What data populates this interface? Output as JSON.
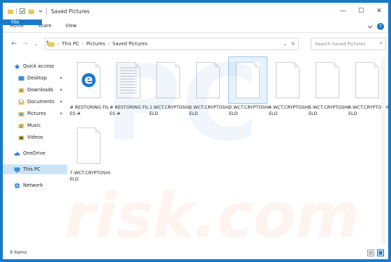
{
  "window": {
    "title": "Saved Pictures"
  },
  "ribbon": {
    "tabs": [
      "File",
      "Home",
      "Share",
      "View"
    ]
  },
  "address": {
    "crumbs": [
      "This PC",
      "Pictures",
      "Saved Pictures"
    ]
  },
  "search": {
    "placeholder": "Search Saved Pictures"
  },
  "sidebar": {
    "items": [
      {
        "label": "Quick access",
        "icon": "star-icon"
      },
      {
        "label": "Desktop",
        "icon": "desktop-folder-icon"
      },
      {
        "label": "Downloads",
        "icon": "downloads-folder-icon"
      },
      {
        "label": "Documents",
        "icon": "documents-folder-icon"
      },
      {
        "label": "Pictures",
        "icon": "pictures-folder-icon"
      },
      {
        "label": "Music",
        "icon": "music-folder-icon"
      },
      {
        "label": "Videos",
        "icon": "videos-folder-icon"
      },
      {
        "label": "OneDrive",
        "icon": "onedrive-cloud-icon"
      },
      {
        "label": "This PC",
        "icon": "computer-icon"
      },
      {
        "label": "Network",
        "icon": "network-icon"
      }
    ]
  },
  "files": [
    {
      "label": "# RESTORING FILES #",
      "type": "edge-html"
    },
    {
      "label": "# RESTORING FILES #",
      "type": "text"
    },
    {
      "label": "1.WCT.CRYPTOSHIELD",
      "type": "blank"
    },
    {
      "label": "2.WCT.CRYPTOSHIELD",
      "type": "blank"
    },
    {
      "label": "3.WCT.CRYPTOSHIELD",
      "type": "blank",
      "selected": true
    },
    {
      "label": "4.WCT.CRYPTOSHIELD",
      "type": "blank"
    },
    {
      "label": "5.WCT.CRYPTOSHIELD",
      "type": "blank"
    },
    {
      "label": "6.WCT.CRYPTOSHIELD",
      "type": "blank"
    },
    {
      "label": "7.WCT.CRYPTOSHIELD",
      "type": "blank"
    }
  ],
  "status": {
    "count": "9 items"
  },
  "colors": {
    "accent": "#1979ca",
    "selection": "#cce4f7"
  },
  "watermark": "PC risk.com"
}
